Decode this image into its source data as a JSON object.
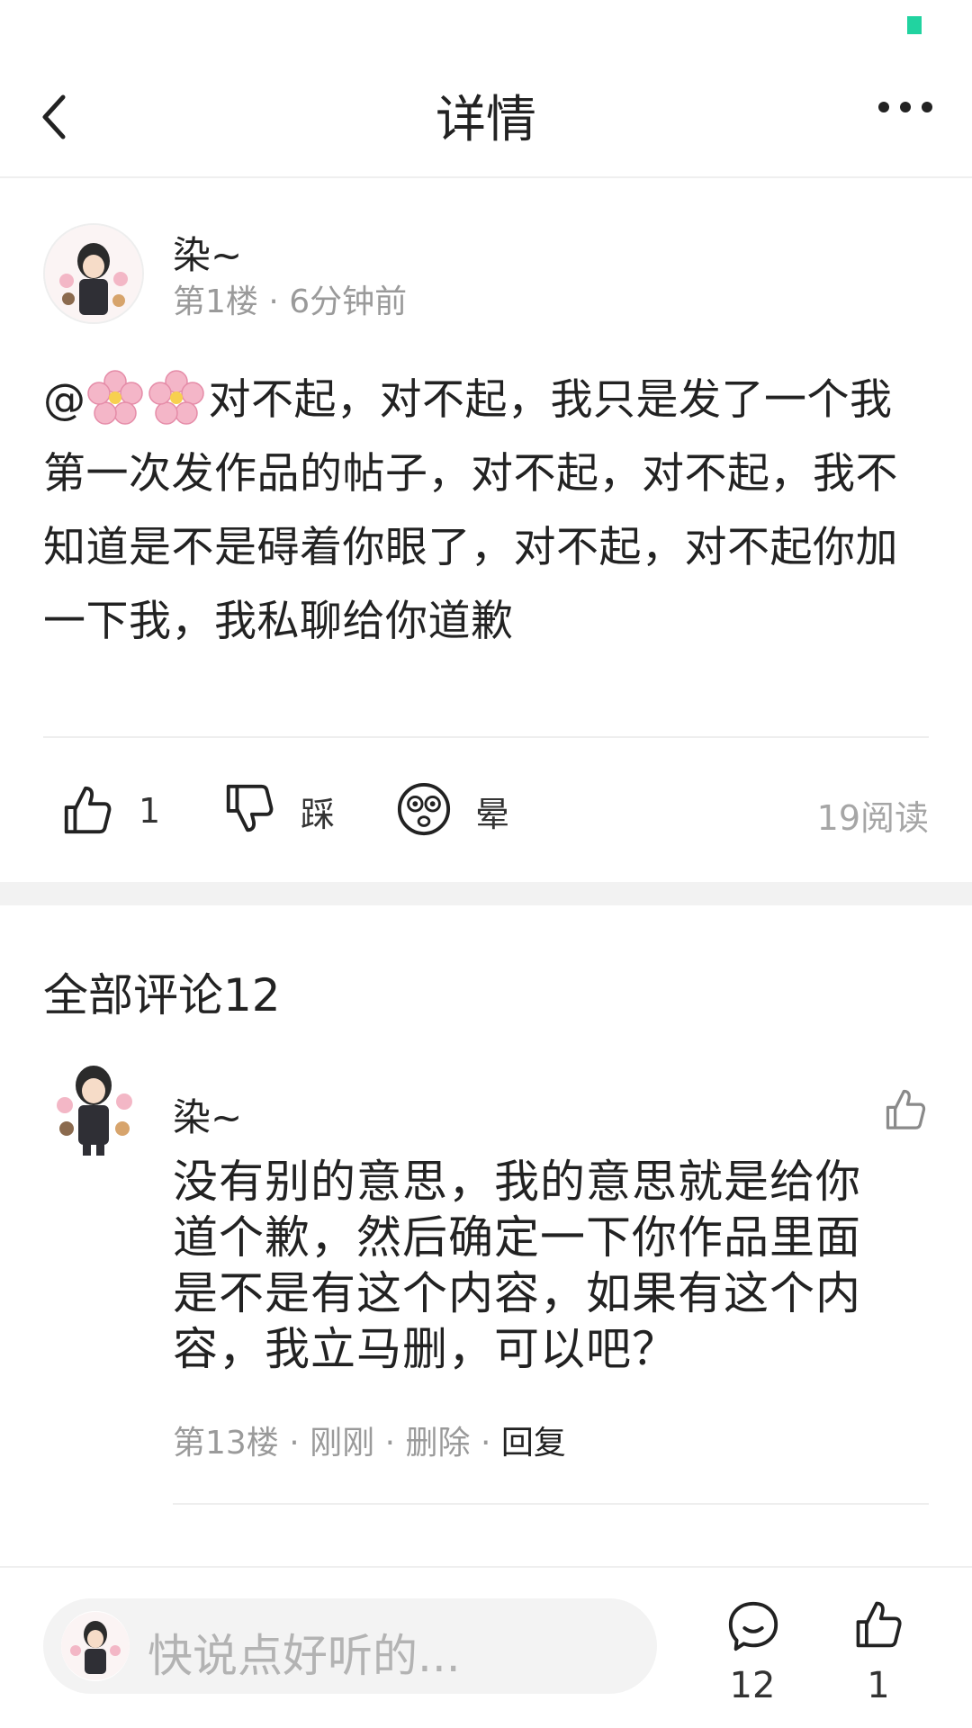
{
  "header": {
    "title": "详情"
  },
  "post": {
    "author": "染~",
    "meta": "第1楼 · 6分钟前",
    "mention_prefix": "@",
    "body_text": "对不起，对不起，我只是发了一个我第一次发作品的帖子，对不起，对不起，我不知道是不是碍着你眼了，对不起，对不起你加一下我，我私聊给你道歉",
    "actions": {
      "like_count": "1",
      "dislike_label": "踩",
      "dizzy_label": "晕"
    },
    "read_count": "19阅读"
  },
  "comments": {
    "title": "全部评论12",
    "items": [
      {
        "author": "染~",
        "body": "没有别的意思，我的意思就是给你道个歉，然后确定一下你作品里面是不是有这个内容，如果有这个内容，我立马删，可以吧？",
        "floor": "第13楼",
        "time": "刚刚",
        "delete_label": "删除",
        "reply_label": "回复"
      }
    ]
  },
  "bottom_bar": {
    "input_placeholder": "快说点好听的...",
    "comment_count": "12",
    "like_count": "1"
  },
  "icons": {
    "back": "chevron-left-icon",
    "more": "more-horizontal-icon",
    "like": "thumbs-up-icon",
    "dislike": "thumbs-down-icon",
    "dizzy": "dizzy-face-icon",
    "comment": "chat-bubble-icon",
    "emoji": "cherry-blossom-emoji"
  },
  "colors": {
    "status_accent": "#21d3a0",
    "text_primary": "#222222",
    "text_secondary": "#9a9a9a",
    "section_gap": "#f2f2f2"
  }
}
